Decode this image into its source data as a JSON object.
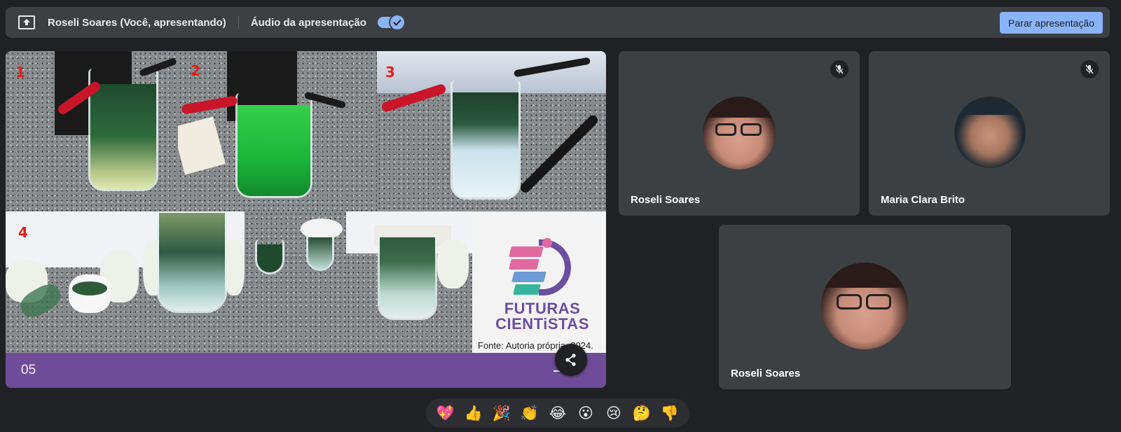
{
  "topbar": {
    "presenter_label": "Roseli Soares (Você, apresentando)",
    "audio_label": "Áudio da apresentação",
    "audio_enabled": true,
    "stop_button": "Parar apresentação"
  },
  "slide": {
    "photo_labels": [
      "1",
      "2",
      "3",
      "4"
    ],
    "logo_line1": "FUTURAS",
    "logo_line2": "CIENTiSTAS",
    "source_caption": "Fonte: Autoria própria, 2024.",
    "page_number": "05",
    "brand_colors": {
      "footer": "#6f4c97",
      "pink": "#e0699f",
      "blue": "#6c9bd6",
      "teal": "#38b49c",
      "purple": "#6b4ea0"
    }
  },
  "participants": [
    {
      "name": "Roseli Soares",
      "muted": true,
      "icon": "mic-off-icon"
    },
    {
      "name": "Maria Clara Brito",
      "muted": true,
      "icon": "mic-off-icon"
    },
    {
      "name": "Roseli Soares",
      "muted": false
    }
  ],
  "reactions": [
    "💖",
    "👍",
    "🎉",
    "👏",
    "😂",
    "😮",
    "😢",
    "🤔",
    "👎"
  ],
  "icons": {
    "present": "present-to-all-icon",
    "share": "share-icon",
    "toggle_check": "check-icon"
  },
  "theme": {
    "background": "#202124",
    "surface": "#3c4043",
    "accent": "#8ab4f8"
  }
}
